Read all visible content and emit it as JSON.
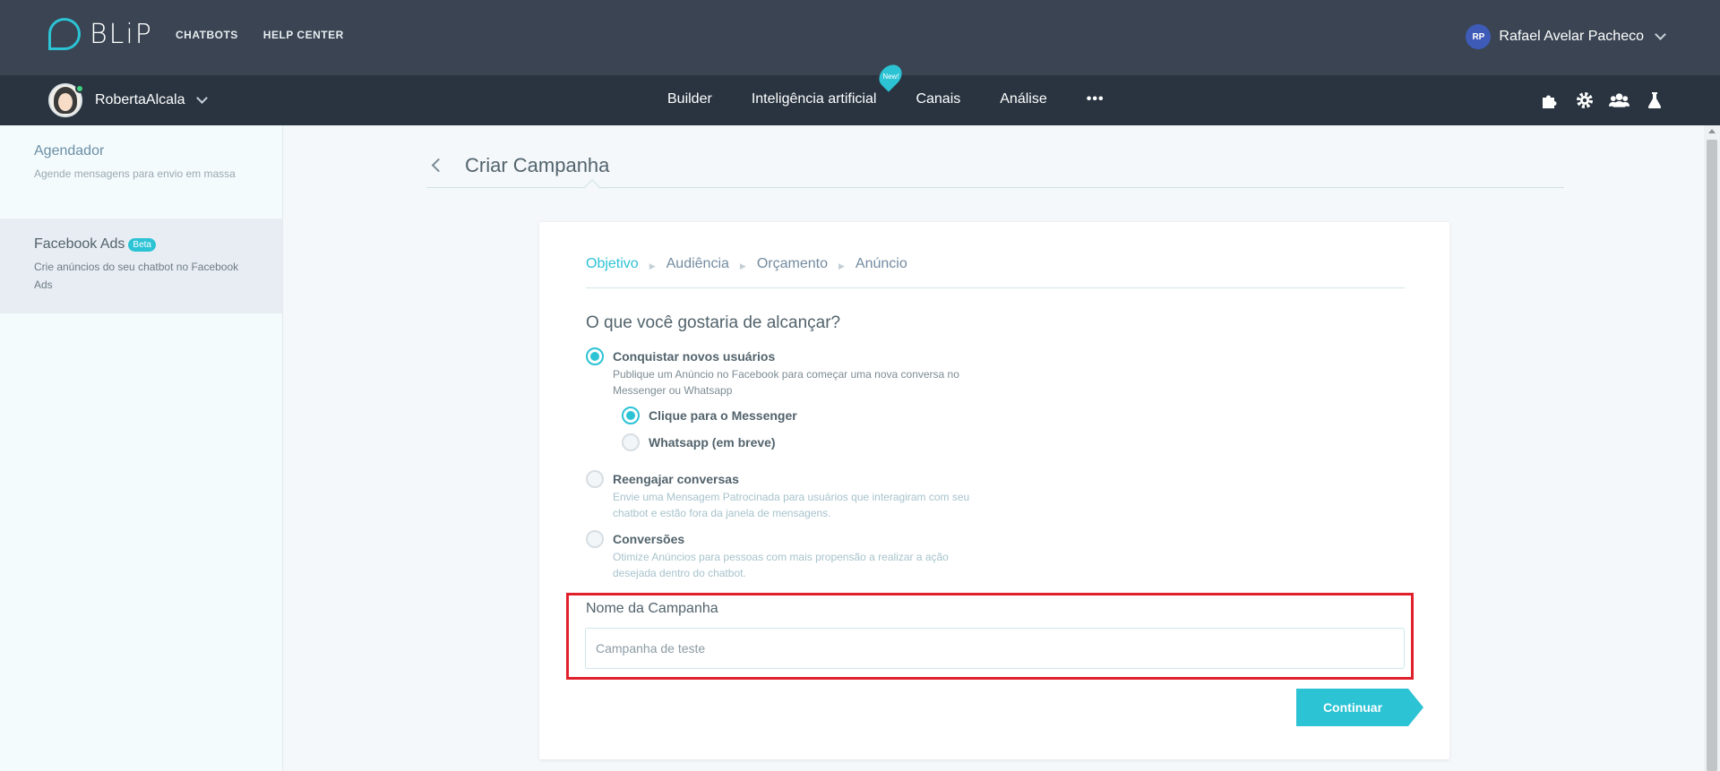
{
  "topbar": {
    "logo_text": "BLiP",
    "nav": [
      "CHATBOTS",
      "HELP CENTER"
    ],
    "user_initials": "RP",
    "user_name": "Rafael Avelar Pacheco"
  },
  "subbar": {
    "bot_name": "RobertaAlcala",
    "nav": [
      "Builder",
      "Inteligência artificial",
      "Canais",
      "Análise"
    ],
    "new_badge": "New!",
    "more": "•••",
    "tool_icons": [
      "puzzle-icon",
      "gear-icon",
      "team-icon",
      "flask-icon"
    ]
  },
  "sidebar": {
    "items": [
      {
        "title": "Agendador",
        "desc": "Agende mensagens para envio em massa"
      },
      {
        "title": "Facebook Ads",
        "badge": "Beta",
        "desc": "Crie anúncios do seu chatbot no Facebook Ads"
      }
    ]
  },
  "page": {
    "title": "Criar Campanha"
  },
  "steps": [
    "Objetivo",
    "Audiência",
    "Orçamento",
    "Anúncio"
  ],
  "step_separator": "▶",
  "question": "O que você gostaria de alcançar?",
  "options": {
    "novos": {
      "label": "Conquistar novos usuários",
      "desc": "Publique um Anúncio no Facebook para começar uma nova conversa no Messenger ou Whatsapp",
      "selected": true
    },
    "messenger": {
      "label": "Clique para o Messenger",
      "selected": true
    },
    "whatsapp": {
      "label": "Whatsapp (em breve)",
      "selected": false
    },
    "reengajar": {
      "label": "Reengajar conversas",
      "desc": "Envie uma Mensagem Patrocinada para usuários que interagiram com seu chatbot e estão fora da janela de mensagens.",
      "selected": false
    },
    "conversoes": {
      "label": "Conversões",
      "desc": "Otimize Anúncios para pessoas com mais propensão a realizar a ação desejada dentro do chatbot.",
      "selected": false
    }
  },
  "campaign_name": {
    "label": "Nome da Campanha",
    "placeholder": "Campanha de teste",
    "value": ""
  },
  "continue_label": "Continuar",
  "colors": {
    "accent": "#2cc3d5",
    "topbar": "#3a4452",
    "subbar": "#293440",
    "highlight": "#e0202b"
  }
}
